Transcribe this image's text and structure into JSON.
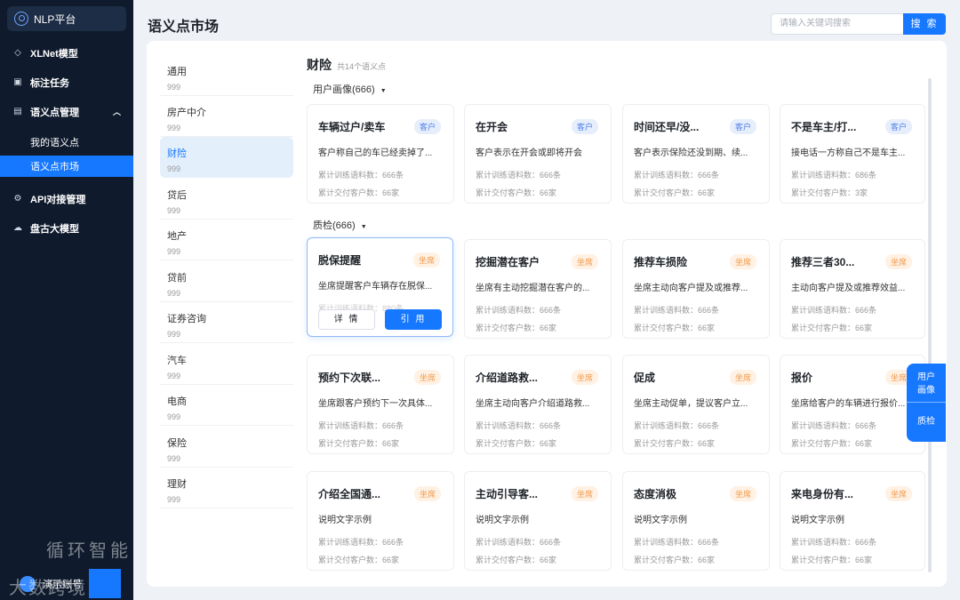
{
  "sidebar": {
    "logo": "NLP平台",
    "items": [
      {
        "label": "XLNet模型"
      },
      {
        "label": "标注任务"
      },
      {
        "label": "语义点管理"
      },
      {
        "label": "API对接管理"
      },
      {
        "label": "盘古大模型"
      }
    ],
    "subitems": [
      {
        "label": "我的语义点"
      },
      {
        "label": "语义点市场"
      }
    ],
    "footer": "演示账号"
  },
  "header": {
    "title": "语义点市场",
    "search_placeholder": "请输入关键词搜索",
    "search_button": "搜 索"
  },
  "categories": [
    {
      "name": "通用",
      "count": "999"
    },
    {
      "name": "房产中介",
      "count": "999"
    },
    {
      "name": "财险",
      "count": "999"
    },
    {
      "name": "贷后",
      "count": "999"
    },
    {
      "name": "地产",
      "count": "999"
    },
    {
      "name": "贷前",
      "count": "999"
    },
    {
      "name": "证券咨询",
      "count": "999"
    },
    {
      "name": "汽车",
      "count": "999"
    },
    {
      "name": "电商",
      "count": "999"
    },
    {
      "name": "保险",
      "count": "999"
    },
    {
      "name": "理财",
      "count": "999"
    }
  ],
  "section": {
    "title": "财险",
    "subtitle": "共14个语义点"
  },
  "groups": [
    {
      "label": "用户画像(666)"
    },
    {
      "label": "质检(666)"
    }
  ],
  "cards": [
    {
      "title": "车辆过户/卖车",
      "tag": "客户",
      "desc": "客户称自己的车已经卖掉了...",
      "m1": "累计训练语料数：666条",
      "m2": "累计交付客户数：66家"
    },
    {
      "title": "在开会",
      "tag": "客户",
      "desc": "客户表示在开会或即将开会",
      "m1": "累计训练语料数：666条",
      "m2": "累计交付客户数：66家"
    },
    {
      "title": "时间还早/没...",
      "tag": "客户",
      "desc": "客户表示保险还没到期、续...",
      "m1": "累计训练语料数：666条",
      "m2": "累计交付客户数：66家"
    },
    {
      "title": "不是车主/打...",
      "tag": "客户",
      "desc": "接电话一方称自己不是车主...",
      "m1": "累计训练语料数：686条",
      "m2": "累计交付客户数：3家"
    },
    {
      "title": "脱保提醒",
      "tag": "坐席",
      "desc": "坐席提醒客户车辆存在脱保...",
      "m1": "累计训练语料数：880条",
      "m2": "",
      "btn1": "详 情",
      "btn2": "引 用"
    },
    {
      "title": "挖掘潜在客户",
      "tag": "坐席",
      "desc": "坐席有主动挖掘潜在客户的...",
      "m1": "累计训练语料数：666条",
      "m2": "累计交付客户数：66家"
    },
    {
      "title": "推荐车损险",
      "tag": "坐席",
      "desc": "坐席主动向客户提及或推荐...",
      "m1": "累计训练语料数：666条",
      "m2": "累计交付客户数：66家"
    },
    {
      "title": "推荐三者30...",
      "tag": "坐席",
      "desc": "主动向客户提及或推荐效益...",
      "m1": "累计训练语料数：666条",
      "m2": "累计交付客户数：66家"
    },
    {
      "title": "预约下次联...",
      "tag": "坐席",
      "desc": "坐席跟客户预约下一次具体...",
      "m1": "累计训练语料数：666条",
      "m2": "累计交付客户数：66家"
    },
    {
      "title": "介绍道路救...",
      "tag": "坐席",
      "desc": "坐席主动向客户介绍道路救...",
      "m1": "累计训练语料数：666条",
      "m2": "累计交付客户数：66家"
    },
    {
      "title": "促成",
      "tag": "坐席",
      "desc": "坐席主动促单，提议客户立...",
      "m1": "累计训练语料数：666条",
      "m2": "累计交付客户数：66家"
    },
    {
      "title": "报价",
      "tag": "坐席",
      "desc": "坐席给客户的车辆进行报价...",
      "m1": "累计训练语料数：666条",
      "m2": "累计交付客户数：66家"
    },
    {
      "title": "介绍全国通...",
      "tag": "坐席",
      "desc": "说明文字示例",
      "m1": "累计训练语料数：666条",
      "m2": "累计交付客户数：66家"
    },
    {
      "title": "主动引导客...",
      "tag": "坐席",
      "desc": "说明文字示例",
      "m1": "累计训练语料数：666条",
      "m2": "累计交付客户数：66家"
    },
    {
      "title": "态度消极",
      "tag": "坐席",
      "desc": "说明文字示例",
      "m1": "累计训练语料数：666条",
      "m2": "累计交付客户数：66家"
    },
    {
      "title": "来电身份有...",
      "tag": "坐席",
      "desc": "说明文字示例",
      "m1": "累计训练语料数：666条",
      "m2": "累计交付客户数：66家"
    }
  ],
  "sidetab": {
    "a": "用户\n画像",
    "b": "质检"
  },
  "watermark": {
    "line1": "循环智能",
    "line2": "大数跨境"
  },
  "colors": {
    "accent": "#1677ff",
    "sidebar": "#0f1b2d"
  }
}
